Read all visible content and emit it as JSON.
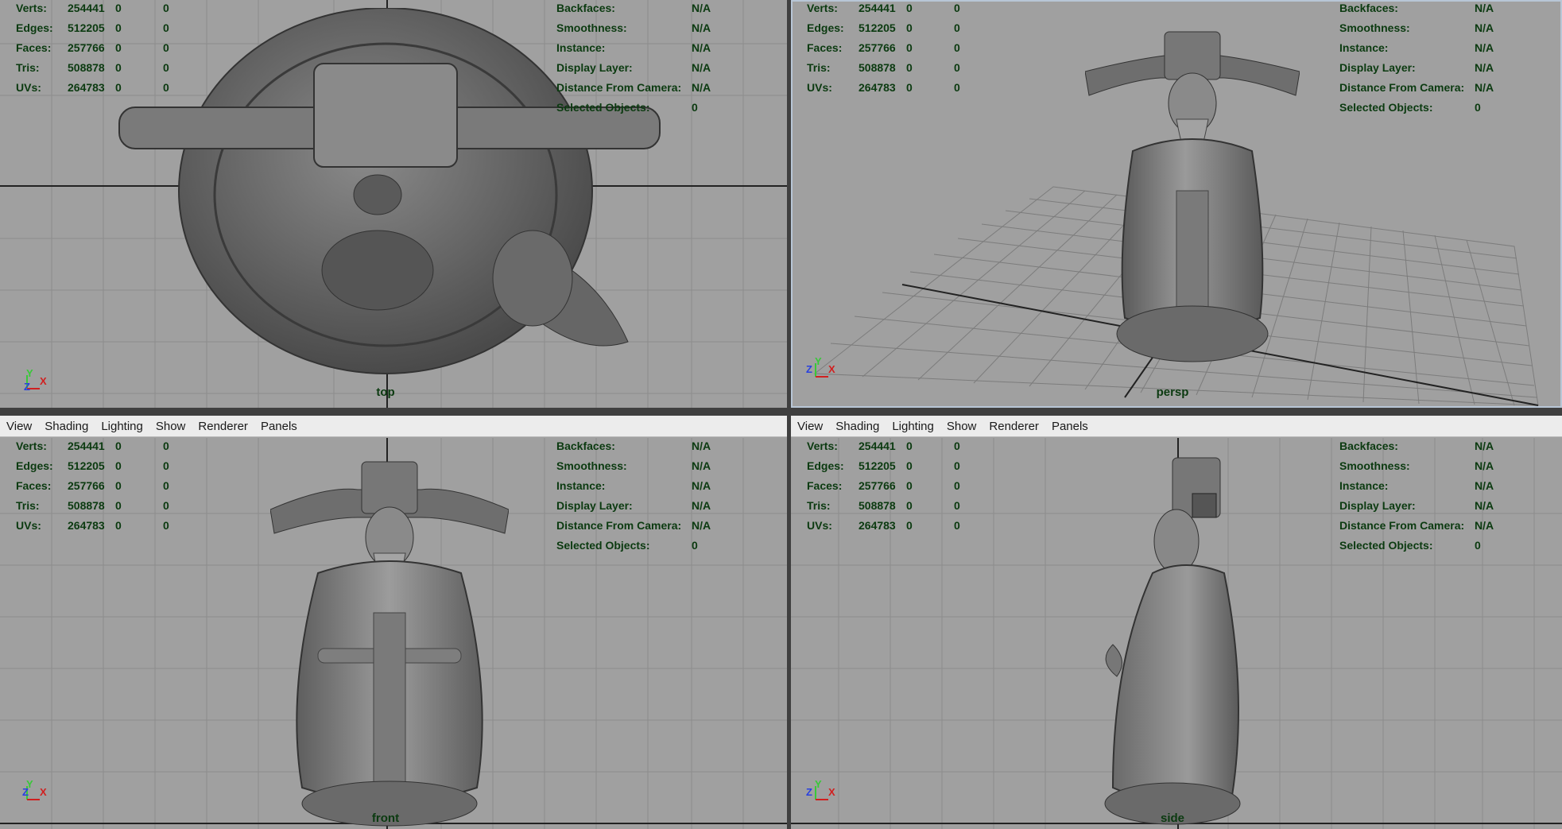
{
  "menu": [
    "View",
    "Shading",
    "Lighting",
    "Show",
    "Renderer",
    "Panels"
  ],
  "hud_left": {
    "rows": [
      {
        "label": "Verts:",
        "a": "254441",
        "b": "0",
        "c": "0"
      },
      {
        "label": "Edges:",
        "a": "512205",
        "b": "0",
        "c": "0"
      },
      {
        "label": "Faces:",
        "a": "257766",
        "b": "0",
        "c": "0"
      },
      {
        "label": "Tris:",
        "a": "508878",
        "b": "0",
        "c": "0"
      },
      {
        "label": "UVs:",
        "a": "264783",
        "b": "0",
        "c": "0"
      }
    ]
  },
  "hud_right": {
    "rows": [
      {
        "label": "Backfaces:",
        "value": "N/A"
      },
      {
        "label": "Smoothness:",
        "value": "N/A"
      },
      {
        "label": "Instance:",
        "value": "N/A"
      },
      {
        "label": "Display Layer:",
        "value": "N/A"
      },
      {
        "label": "Distance From Camera:",
        "value": "N/A"
      },
      {
        "label": "Selected Objects:",
        "value": "0"
      }
    ]
  },
  "panes": {
    "top": {
      "camera": "top"
    },
    "persp": {
      "camera": "persp"
    },
    "front": {
      "camera": "front"
    },
    "side": {
      "camera": "side"
    }
  },
  "axis_labels": {
    "x": "X",
    "y": "Y",
    "z": "Z"
  },
  "colors": {
    "viewport_bg": "#a0a0a0",
    "hud_text": "#0b3a10",
    "grid": "#8a8a8a",
    "axis_line": "#222222",
    "menubar_bg": "#ececec"
  }
}
